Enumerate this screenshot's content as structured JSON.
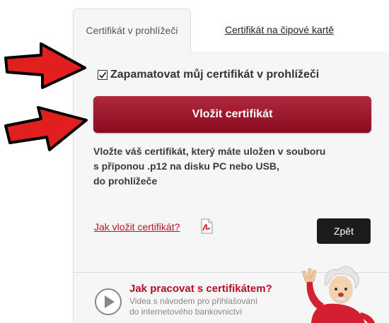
{
  "tabs": {
    "browser": "Certifikát v prohlížeči",
    "smartcard": "Certifikát na čipové kartě"
  },
  "remember": {
    "label": "Zapamatovat můj certifikát v prohlížeči",
    "checked": true
  },
  "insert_button": "Vložit certifikát",
  "description": {
    "line1": "Vložte váš certifikát, který máte uložen v souboru",
    "line2": "s příponou .p12 na disku PC nebo USB,",
    "line3": "do prohlížeče"
  },
  "howto_link": "Jak vložit certifikát?",
  "back_button": "Zpět",
  "video": {
    "title": "Jak pracovat s certifikátem?",
    "subtitle1": "Videa s návodem pro přihlašování",
    "subtitle2": "do internetového bankovnictví"
  },
  "colors": {
    "brand": "#a01a30",
    "arrow": "#e02020"
  },
  "icons": {
    "pdf": "pdf-icon",
    "play": "play-circle-icon"
  }
}
